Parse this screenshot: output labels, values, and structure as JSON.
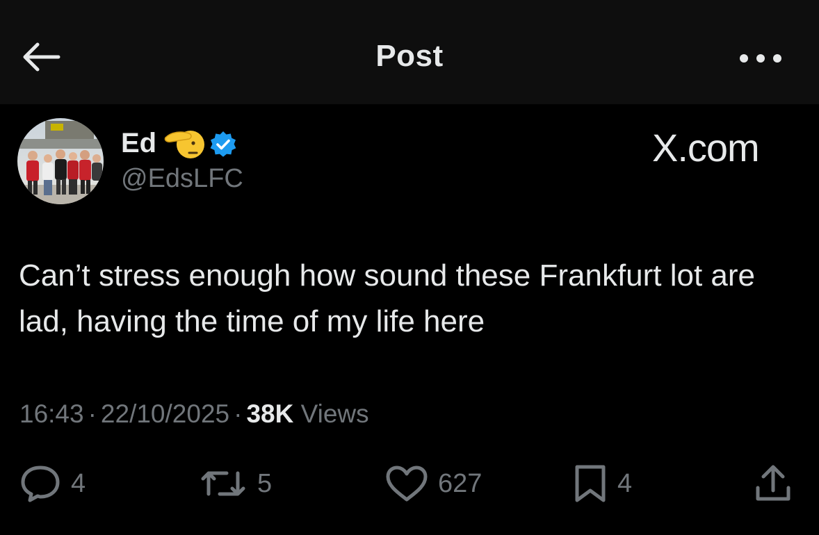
{
  "header": {
    "title": "Post",
    "back_icon": "arrow-left-icon",
    "more_icon": "more-horizontal-icon"
  },
  "author": {
    "name": "Ed",
    "handle": "@EdsLFC",
    "emoji": "saluting-face",
    "verified": true,
    "verified_color": "#1d9bf0"
  },
  "watermark": "X.com",
  "post": {
    "text": "Can’t stress enough how sound these Frankfurt lot are lad, having the time of my life here"
  },
  "meta": {
    "time": "16:43",
    "separator": "·",
    "date": "22/10/2025",
    "views_count": "38K",
    "views_label": "Views"
  },
  "actions": {
    "replies": "4",
    "reposts": "5",
    "likes": "627",
    "bookmarks": "4"
  },
  "colors": {
    "background": "#000000",
    "topbar": "#0e0e0e",
    "text_primary": "#e7e9ea",
    "text_secondary": "#71767b",
    "accent": "#1d9bf0"
  }
}
